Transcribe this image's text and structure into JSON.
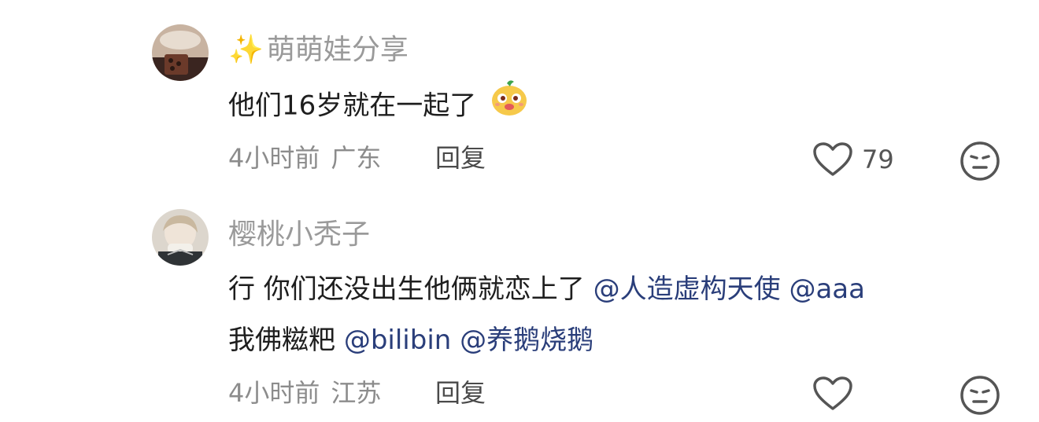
{
  "comments": [
    {
      "username": "萌萌娃分享",
      "username_icon": "sparkles-icon",
      "text": "他们16岁就在一起了",
      "emoji": "cute-face-emoji",
      "time": "4小时前",
      "location": "广东",
      "reply_label": "回复",
      "likes": "79"
    },
    {
      "username": "樱桃小秃子",
      "text_line1": "行 你们还没出生他俩就恋上了",
      "mentions_line1": [
        "@人造虚构天使",
        "@aaa"
      ],
      "text_line2_prefix": "我佛糍粑",
      "mentions_line2": [
        "@bilibin",
        "@养鹅烧鹅"
      ],
      "time": "4小时前",
      "location": "江苏",
      "reply_label": "回复"
    }
  ],
  "colors": {
    "mention": "#2a3e7a",
    "meta": "#8c8c8c",
    "username": "#9a9a9a"
  }
}
